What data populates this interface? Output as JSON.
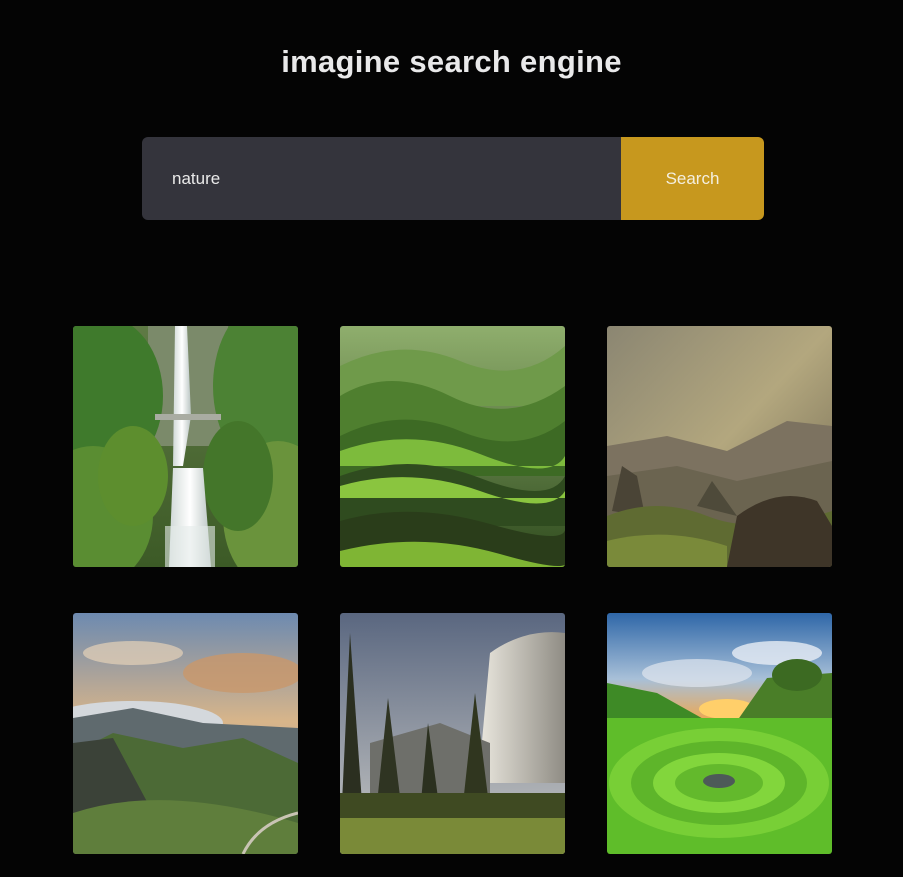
{
  "header": {
    "title": "imagine search engine"
  },
  "search": {
    "query": "nature",
    "button_label": "Search"
  },
  "results": [
    {
      "subject": "waterfall with footbridge in green gorge"
    },
    {
      "subject": "rolling green moss hills"
    },
    {
      "subject": "misty mountains at sunrise with rock outcrops"
    },
    {
      "subject": "green valley with clouds and sunset sky"
    },
    {
      "subject": "granite cliff and tall pine trees"
    },
    {
      "subject": "grassy spiral meadow with stone circle at sunset"
    }
  ],
  "colors": {
    "background": "#040404",
    "input": "#34343c",
    "accent": "#c7981e",
    "title": "#e9e9ea"
  }
}
